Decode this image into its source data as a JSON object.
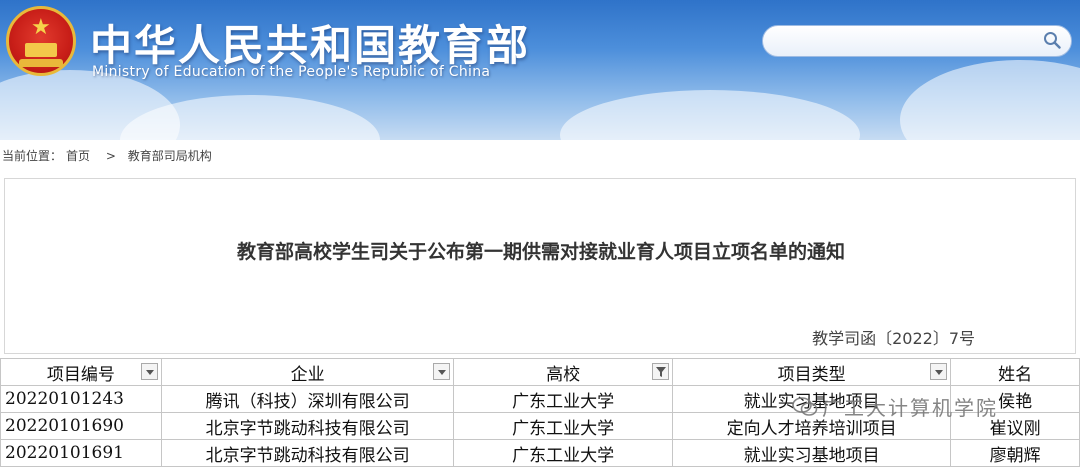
{
  "header": {
    "title": "中华人民共和国教育部",
    "subtitle": "Ministry of Education of the People's Republic of China",
    "search_placeholder": ""
  },
  "breadcrumb": {
    "label": "当前位置：",
    "home": "首页",
    "separator": ">",
    "current": "教育部司局机构"
  },
  "notice": {
    "title": "教育部高校学生司关于公布第一期供需对接就业育人项目立项名单的通知",
    "doc_number": "教学司函〔2022〕7号"
  },
  "table": {
    "headers": [
      "项目编号",
      "企业",
      "高校",
      "项目类型",
      "姓名"
    ],
    "rows": [
      [
        "20220101243",
        "腾讯（科技）深圳有限公司",
        "广东工业大学",
        "就业实习基地项目",
        "侯艳"
      ],
      [
        "20220101690",
        "北京字节跳动科技有限公司",
        "广东工业大学",
        "定向人才培养培训项目",
        "崔议刚"
      ],
      [
        "20220101691",
        "北京字节跳动科技有限公司",
        "广东工业大学",
        "就业实习基地项目",
        "廖朝辉"
      ]
    ]
  },
  "watermark": "广工大计算机学院",
  "colors": {
    "header_blue": "#3b7fd2",
    "emblem_red": "#c81e18",
    "emblem_gold": "#e8b93a"
  }
}
